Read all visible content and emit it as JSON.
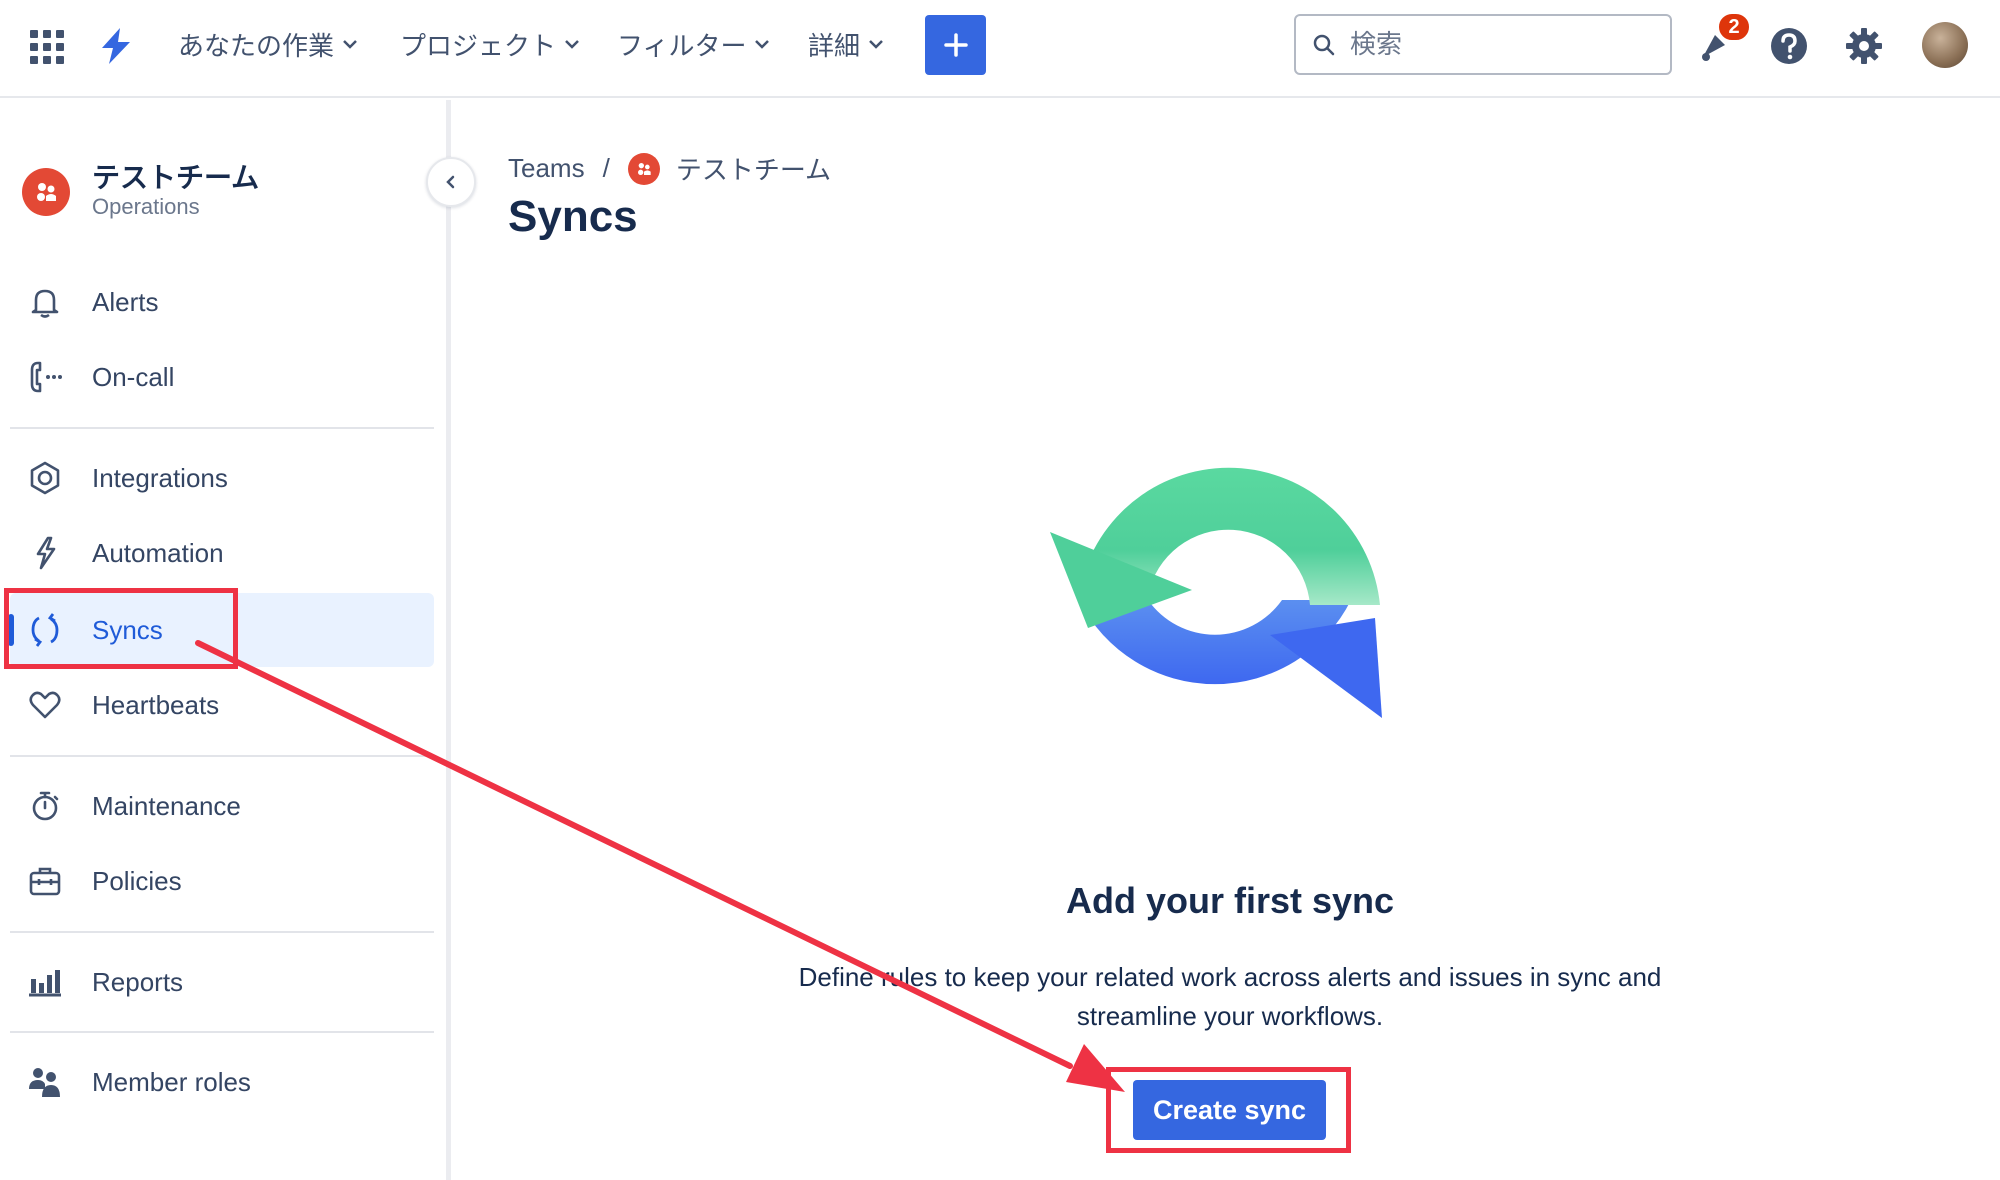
{
  "topbar": {
    "nav": [
      {
        "label": "あなたの作業"
      },
      {
        "label": "プロジェクト"
      },
      {
        "label": "フィルター"
      },
      {
        "label": "詳細"
      }
    ],
    "search_placeholder": "検索",
    "notification_count": "2",
    "icons": [
      "app-switcher-icon",
      "jira-logo-icon",
      "plus-icon",
      "search-icon",
      "notification-icon",
      "help-icon",
      "settings-icon",
      "avatar"
    ]
  },
  "sidebar": {
    "team_name": "テストチーム",
    "team_type": "Operations",
    "groups": [
      [
        {
          "label": "Alerts",
          "icon": "bell-icon"
        },
        {
          "label": "On-call",
          "icon": "phone-icon"
        }
      ],
      [
        {
          "label": "Integrations",
          "icon": "integrations-icon"
        },
        {
          "label": "Automation",
          "icon": "lightning-icon"
        },
        {
          "label": "Syncs",
          "icon": "sync-icon",
          "active": true
        },
        {
          "label": "Heartbeats",
          "icon": "heart-icon"
        }
      ],
      [
        {
          "label": "Maintenance",
          "icon": "stopwatch-icon"
        },
        {
          "label": "Policies",
          "icon": "briefcase-icon"
        }
      ],
      [
        {
          "label": "Reports",
          "icon": "chart-icon"
        }
      ],
      [
        {
          "label": "Member roles",
          "icon": "people-icon"
        }
      ]
    ]
  },
  "breadcrumb": {
    "root": "Teams",
    "separator": "/",
    "team": "テストチーム"
  },
  "page": {
    "title": "Syncs",
    "empty_title": "Add your first sync",
    "empty_description": "Define rules to keep your related work across alerts and issues in sync and streamline your workflows.",
    "primary_button": "Create sync"
  },
  "colors": {
    "accent": "#3567e0",
    "annotation": "#ee3244",
    "team_icon": "#e34935",
    "active_bg": "#e9f2ff"
  }
}
